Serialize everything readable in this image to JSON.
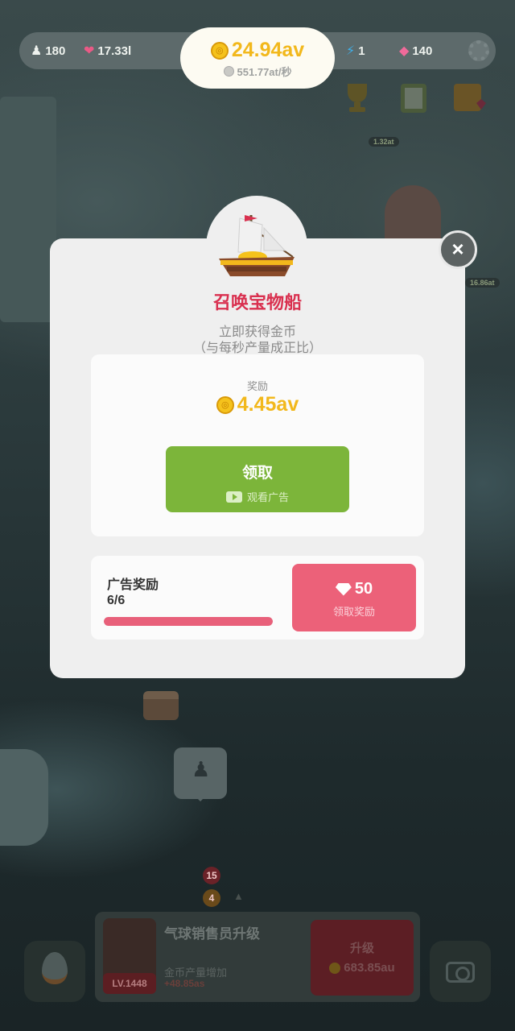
{
  "status_bar": {
    "population": "180",
    "hearts": "17.33l",
    "gold": "24.94av",
    "gold_rate": "551.77at/秒",
    "energy": "1",
    "gems": "140"
  },
  "modal": {
    "title": "召唤宝物船",
    "description_line1": "立即获得金币",
    "description_line2": "（与每秒产量成正比）",
    "reward_label": "奖励",
    "reward_amount": "4.45av",
    "claim_button_label": "领取",
    "claim_button_sublabel": "观看广告",
    "ad_reward_label": "广告奖励",
    "ad_reward_count": "6/6",
    "ad_reward_progress": 1.0,
    "gem_reward_amount": "50",
    "gem_reward_button_label": "领取奖励",
    "close_glyph": "×"
  },
  "background": {
    "badge_top": "15",
    "badge_bottom": "4",
    "label_1": "1.32at",
    "label_2": "16.86at"
  },
  "upgrade_panel": {
    "level": "LV.1448",
    "title": "气球销售员升级",
    "subtitle": "金币产量增加",
    "bonus": "+48.85as",
    "button_label": "升级",
    "button_cost": "683.85au"
  },
  "icons": {
    "population": "penguin-icon",
    "hearts": "heart-icon",
    "gold": "gold-coin-icon",
    "energy": "lightning-icon",
    "gems": "gem-icon",
    "settings": "gear-icon",
    "trophy": "trophy-icon",
    "clipboard": "clipboard-icon",
    "shop": "shop-icon",
    "ship": "treasure-ship-icon",
    "close": "close-icon",
    "video": "video-play-icon",
    "egg": "egg-icon",
    "camera": "camera-icon"
  },
  "colors": {
    "title_red": "#d9304f",
    "gold": "#f2b81c",
    "claim_green": "#7cb53a",
    "gem_pink": "#ec6179",
    "progress_pink": "#e8607a"
  }
}
